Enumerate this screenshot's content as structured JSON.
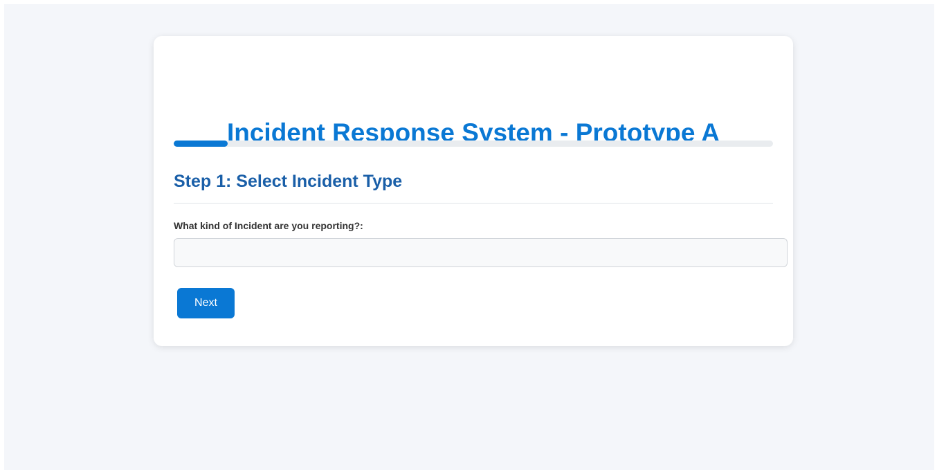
{
  "header": {
    "title": "Incident Response System - Prototype A"
  },
  "progress": {
    "fraction": 0.09
  },
  "step": {
    "heading": "Step 1: Select Incident Type",
    "question_label": "What kind of Incident are you reporting?:",
    "input_value": "",
    "next_label": "Next"
  },
  "colors": {
    "accent": "#0a78d4",
    "heading": "#1a5fa8",
    "background": "#f4f6fa"
  }
}
